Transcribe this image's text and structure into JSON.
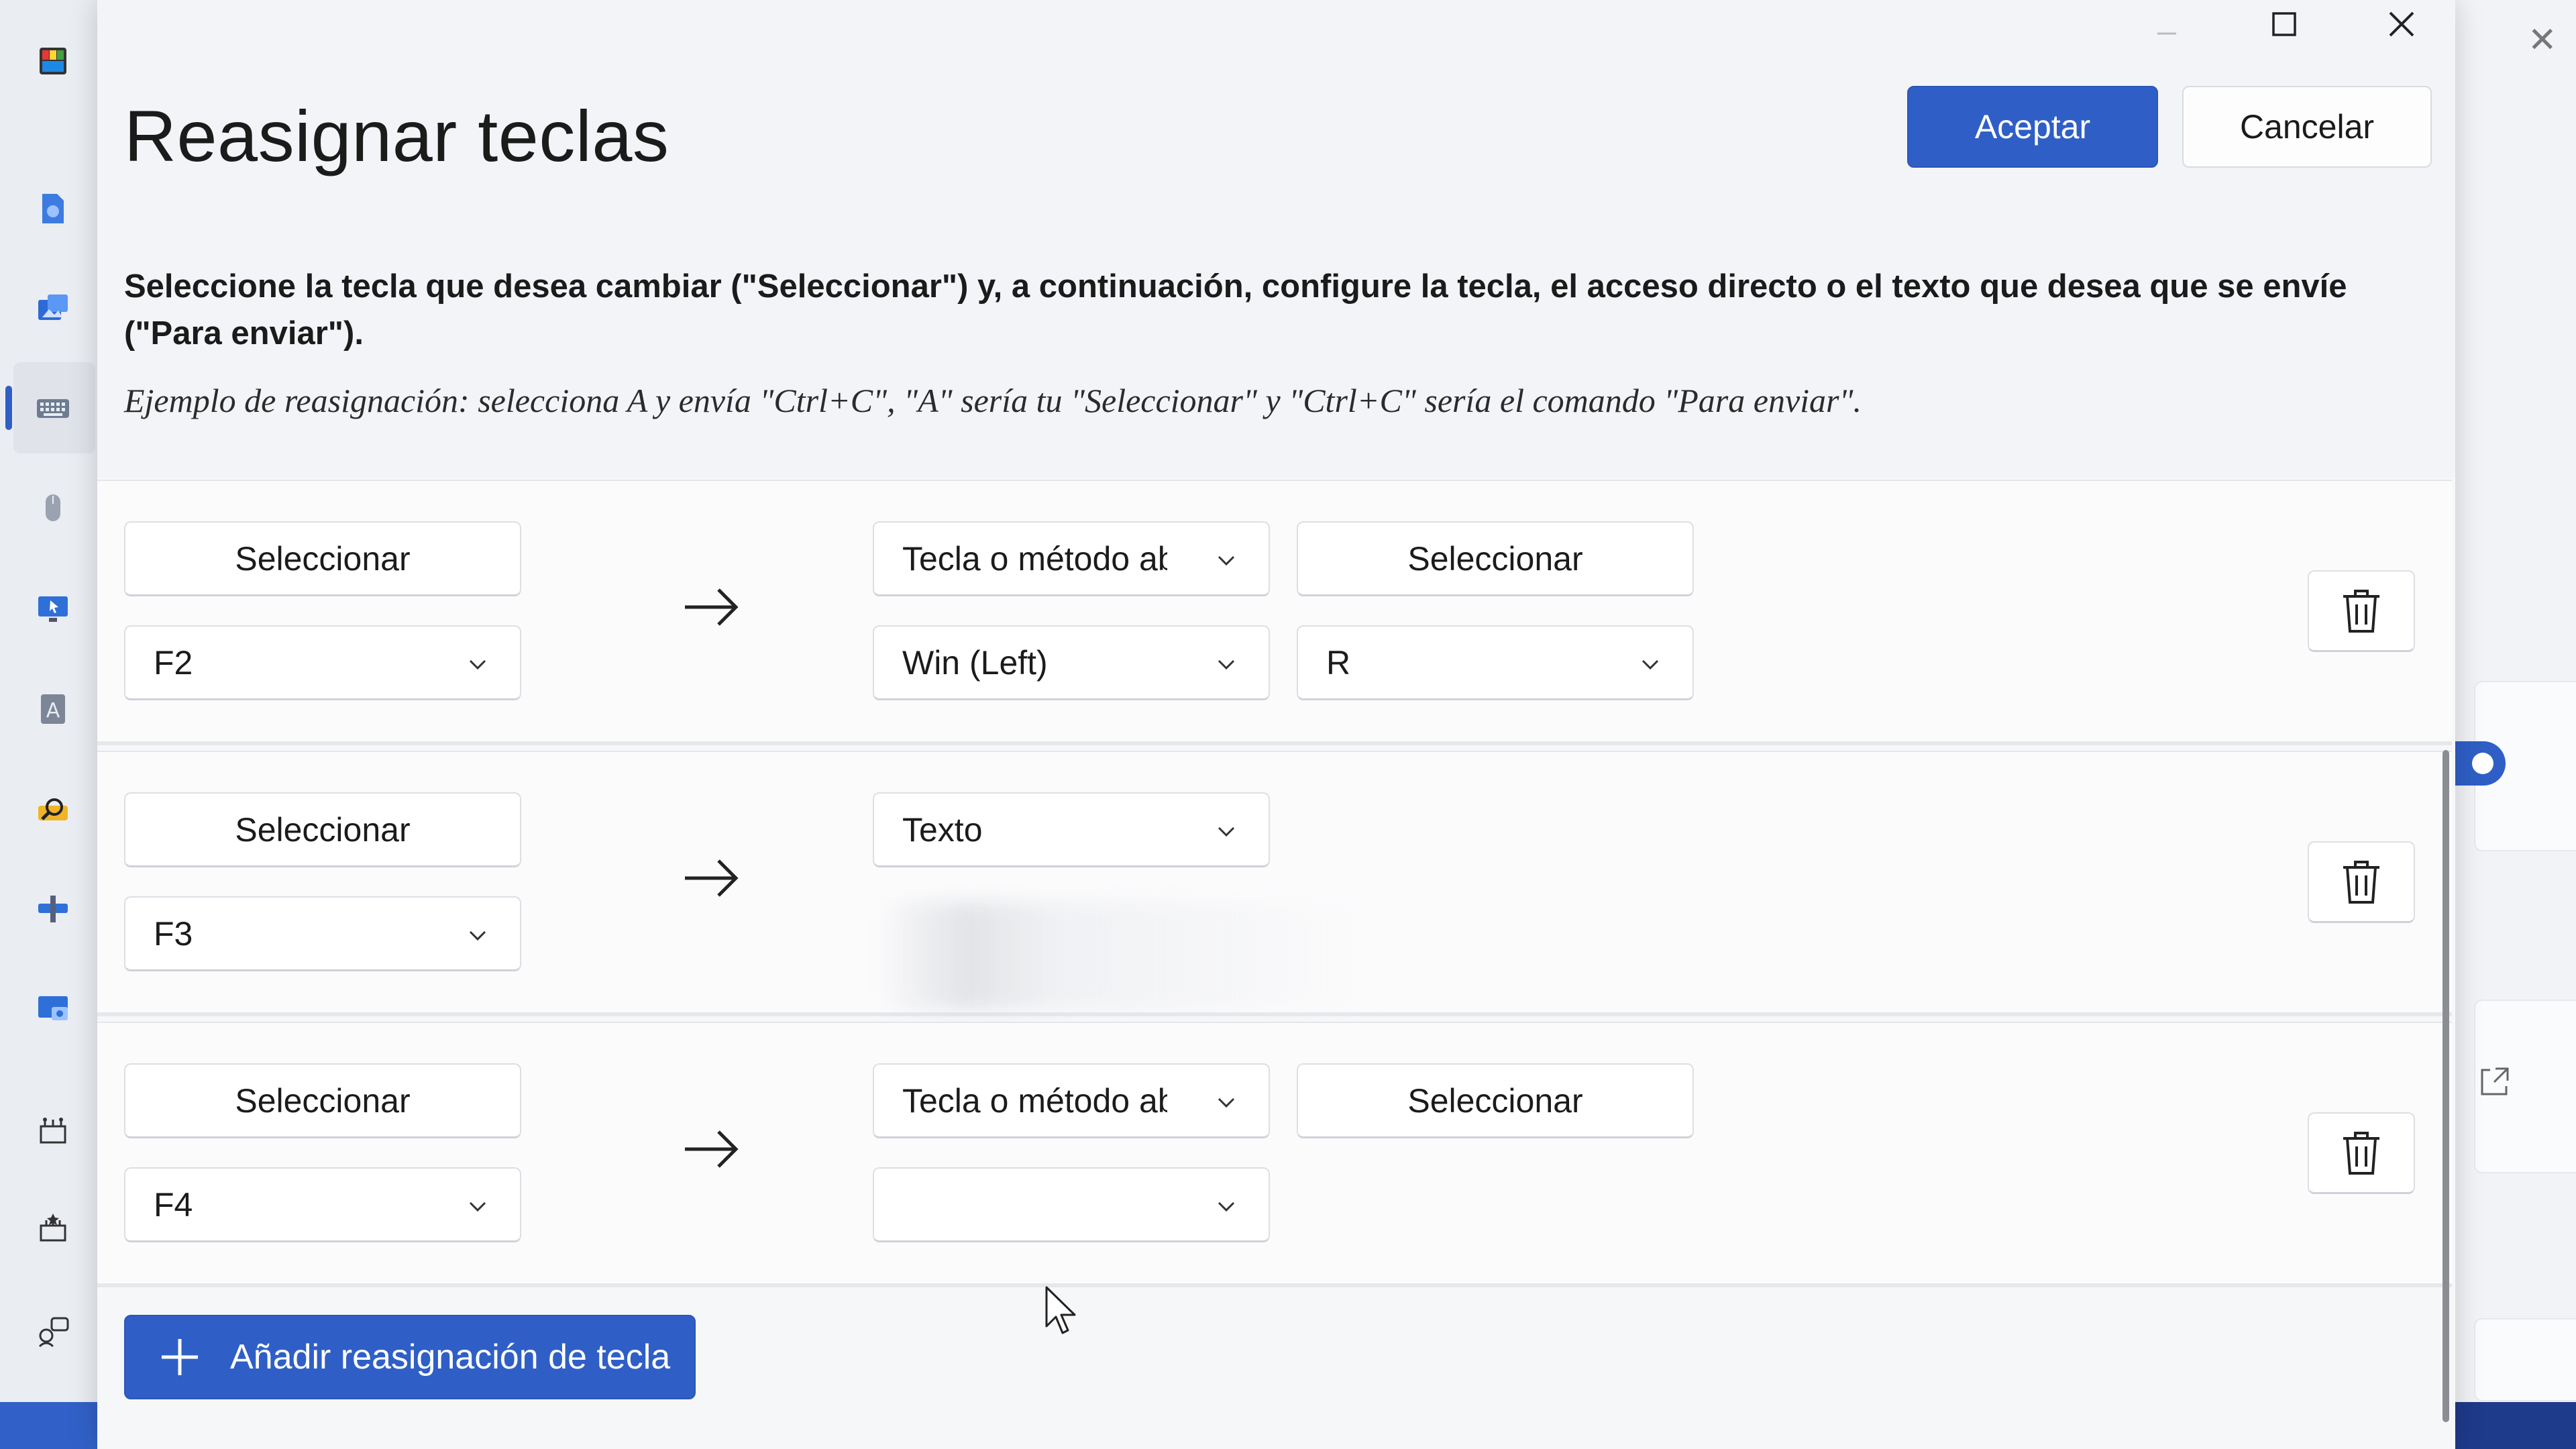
{
  "dialog": {
    "title": "Reasignar teclas",
    "accept_label": "Aceptar",
    "cancel_label": "Cancelar",
    "description": "Seleccione la tecla que desea cambiar (\"Seleccionar\") y, a continuación, configure la tecla, el acceso directo o el texto que desea que se envíe (\"Para enviar\").",
    "example": "Ejemplo de reasignación: selecciona A y envía \"Ctrl+C\", \"A\" sería tu \"Seleccionar\" y \"Ctrl+C\" sería el comando \"Para enviar\".",
    "add_label": "Añadir reasignación de tecla"
  },
  "rows": [
    {
      "source_select_label": "Seleccionar",
      "source_key": "F2",
      "action_type": "Tecla o método abreviado",
      "target_select_label": "Seleccionar",
      "target_key_1": "Win (Left)",
      "target_key_2": "R"
    },
    {
      "source_select_label": "Seleccionar",
      "source_key": "F3",
      "action_type": "Texto"
    },
    {
      "source_select_label": "Seleccionar",
      "source_key": "F4",
      "action_type": "Tecla o método abreviado",
      "target_select_label": "Seleccionar",
      "target_key_1": ""
    }
  ],
  "colors": {
    "accent": "#2f5fc6",
    "dialog_bg": "#f3f4f7",
    "row_bg": "#fbfbfc"
  },
  "icons": {
    "titlebar": [
      "minimize-icon",
      "maximize-icon",
      "close-icon"
    ],
    "row_arrow": "arrow-right-icon",
    "delete": "trash-icon",
    "add": "plus-icon",
    "dropdown": "chevron-down-icon"
  }
}
